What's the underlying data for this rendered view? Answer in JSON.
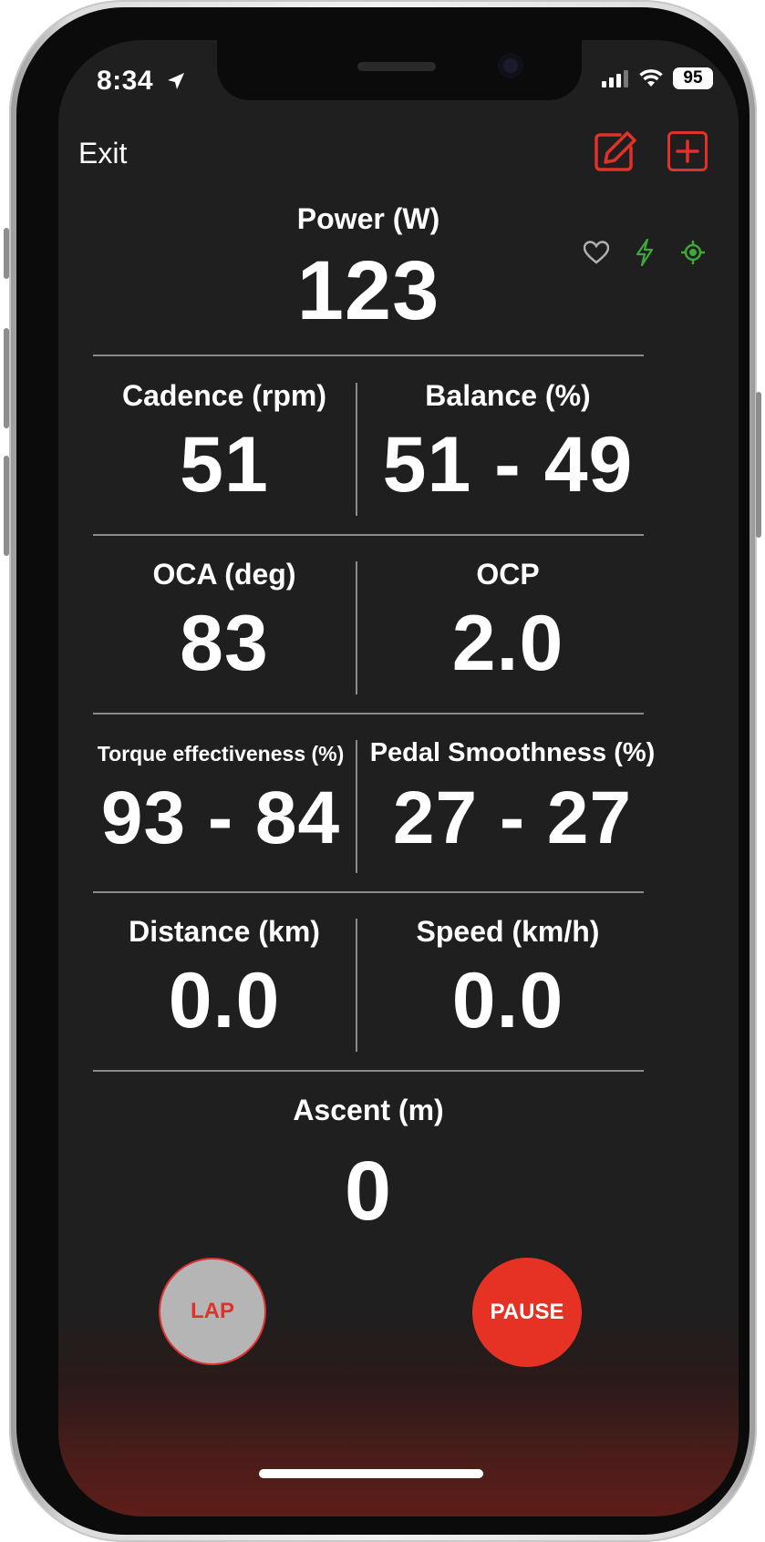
{
  "status_bar": {
    "time": "8:34",
    "battery": "95",
    "location_icon": "location-arrow-icon",
    "signal_icon": "cellular-signal-icon",
    "wifi_icon": "wifi-icon"
  },
  "toolbar": {
    "exit_label": "Exit",
    "edit_icon": "edit-icon",
    "add_icon": "add-icon"
  },
  "indicators": {
    "heart": "heart-icon",
    "bolt": "bolt-icon",
    "gps": "gps-target-icon",
    "heart_color": "#b0b0b0",
    "bolt_color": "#3fa83a",
    "gps_color": "#3fa83a"
  },
  "metrics": {
    "power": {
      "label": "Power (W)",
      "value": "123"
    },
    "cadence": {
      "label": "Cadence (rpm)",
      "value": "51"
    },
    "balance": {
      "label": "Balance (%)",
      "value": "51 - 49"
    },
    "oca": {
      "label": "OCA (deg)",
      "value": "83"
    },
    "ocp": {
      "label": "OCP",
      "value": "2.0"
    },
    "torque": {
      "label": "Torque effectiveness (%)",
      "value": "93 - 84"
    },
    "smoothness": {
      "label": "Pedal Smoothness (%)",
      "value": "27 - 27"
    },
    "distance": {
      "label": "Distance (km)",
      "value": "0.0"
    },
    "speed": {
      "label": "Speed (km/h)",
      "value": "0.0"
    },
    "ascent": {
      "label": "Ascent (m)",
      "value": "0"
    }
  },
  "controls": {
    "lap_label": "LAP",
    "pause_label": "PAUSE"
  },
  "colors": {
    "accent": "#e63225",
    "background": "#1f1f1f",
    "text": "#ffffff"
  }
}
